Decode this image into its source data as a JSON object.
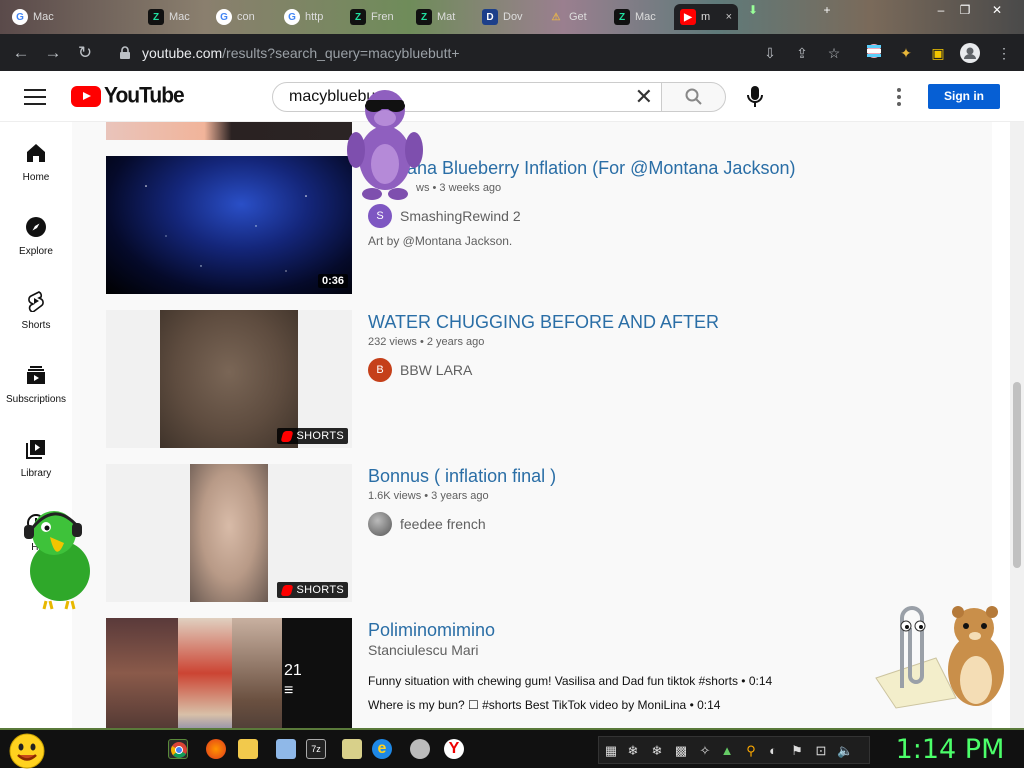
{
  "browser": {
    "tabs": [
      {
        "label": "Mac",
        "icon": "google-icon",
        "active": false
      },
      {
        "label": "Mac",
        "icon": "zerogpt-icon",
        "active": false
      },
      {
        "label": "con",
        "icon": "google-icon",
        "active": false
      },
      {
        "label": "http",
        "icon": "google-icon",
        "active": false
      },
      {
        "label": "Fren",
        "icon": "zerogpt-icon",
        "active": false
      },
      {
        "label": "Mat",
        "icon": "zerogpt-icon",
        "active": false
      },
      {
        "label": "Dov",
        "icon": "download-site-icon",
        "active": false
      },
      {
        "label": "Get",
        "icon": "warning-icon",
        "active": false
      },
      {
        "label": "Mac",
        "icon": "zerogpt-icon",
        "active": false
      },
      {
        "label": "m",
        "icon": "youtube-icon",
        "active": true
      }
    ],
    "url_host": "youtube.com",
    "url_path": "/results?search_query=macybluebutt+"
  },
  "masthead": {
    "logo_text": "YouTube",
    "search_value": "macybluebu",
    "signin_label": "Sign in"
  },
  "guide": {
    "items": [
      {
        "label": "Home",
        "icon": "home-icon"
      },
      {
        "label": "Explore",
        "icon": "compass-icon"
      },
      {
        "label": "Shorts",
        "icon": "shorts-icon"
      },
      {
        "label": "Subscriptions",
        "icon": "subscriptions-icon"
      },
      {
        "label": "Library",
        "icon": "library-icon"
      },
      {
        "label": "Hi",
        "icon": "history-icon"
      }
    ]
  },
  "results": [
    {
      "title": "Montana Blueberry Inflation (For @Montana Jackson)",
      "title_visible": "tana Blueberry Inflation (For @Montana Jackson)",
      "meta": "6 views • 3 weeks ago",
      "meta_visible": "ws • 3 weeks ago",
      "channel": "SmashingRewind 2",
      "avatar_letter": "S",
      "avatar_color": "#7e57c2",
      "description": "Art by @Montana Jackson.",
      "duration": "0:36"
    },
    {
      "title": "WATER CHUGGING BEFORE AND AFTER",
      "meta": "232 views • 2 years ago",
      "channel": "BBW LARA",
      "avatar_letter": "B",
      "avatar_color": "#c5401a",
      "badge": "SHORTS"
    },
    {
      "title": "Bonnus ( inflation final )",
      "meta": "1.6K views • 3 years ago",
      "channel": "feedee french",
      "avatar_letter": "",
      "avatar_color": "#777777",
      "badge": "SHORTS"
    },
    {
      "title": "Poliminomimino",
      "channel": "Stanciulescu Mari",
      "playlist_count": "21",
      "mix_lines": [
        "Funny situation with chewing gum! Vasilisa and Dad fun tiktok #shorts • 0:14",
        "Where is my bun? ☐ #shorts Best TikTok video by MoniLina • 0:14"
      ]
    }
  ],
  "taskbar": {
    "clock": "1:14 PM"
  },
  "colors": {
    "title_link": "#2a6ea6",
    "youtube_red": "#ff0000",
    "signin_blue": "#065fd4",
    "clock_green": "#4cff6a"
  }
}
